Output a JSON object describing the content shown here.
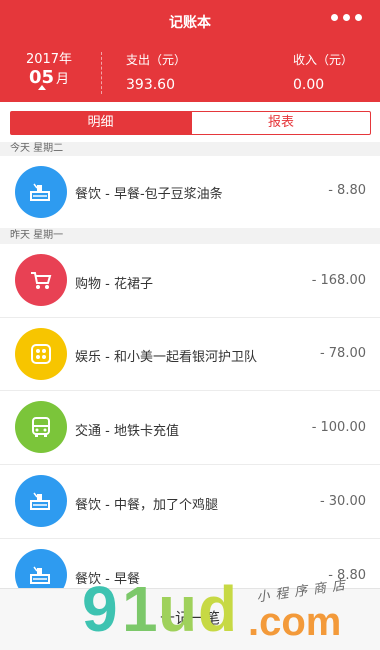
{
  "header": {
    "title": "记账本",
    "year": "2017年",
    "month_num": "05",
    "month_unit": "月",
    "expense_label": "支出（元）",
    "expense_value": "393.60",
    "income_label": "收入（元）",
    "income_value": "0.00"
  },
  "tabs": [
    {
      "label": "明细",
      "active": true
    },
    {
      "label": "报表",
      "active": false
    }
  ],
  "days": [
    {
      "label": "今天 星期二"
    },
    {
      "label": "昨天 星期一"
    }
  ],
  "entries": [
    {
      "icon": "food-icon",
      "color": "#2e9bf0",
      "text": "餐饮 - 早餐-包子豆浆油条",
      "amount": "- 8.80"
    },
    {
      "icon": "cart-icon",
      "color": "#e84154",
      "text": "购物 - 花裙子",
      "amount": "- 168.00"
    },
    {
      "icon": "game-icon",
      "color": "#f7c500",
      "text": "娱乐 - 和小美一起看银河护卫队",
      "amount": "- 78.00"
    },
    {
      "icon": "bus-icon",
      "color": "#7bc53a",
      "text": "交通 - 地铁卡充值",
      "amount": "- 100.00"
    },
    {
      "icon": "food-icon",
      "color": "#2e9bf0",
      "text": "餐饮 - 中餐，加了个鸡腿",
      "amount": "- 30.00"
    },
    {
      "icon": "food-icon",
      "color": "#2e9bf0",
      "text": "餐饮 - 早餐",
      "amount": "- 8.80"
    }
  ],
  "bottom": {
    "add_label": "十记一笔"
  },
  "watermark": {
    "logo_a": "9",
    "logo_b": "1",
    "logo_c": "u",
    "logo_d": "d",
    "dot_com": ".com",
    "tagline": "小程序商店"
  },
  "colors": {
    "brand": "#e5373b",
    "food": "#2e9bf0",
    "shopping": "#e84154",
    "entertainment": "#f7c500",
    "transport": "#7bc53a"
  }
}
